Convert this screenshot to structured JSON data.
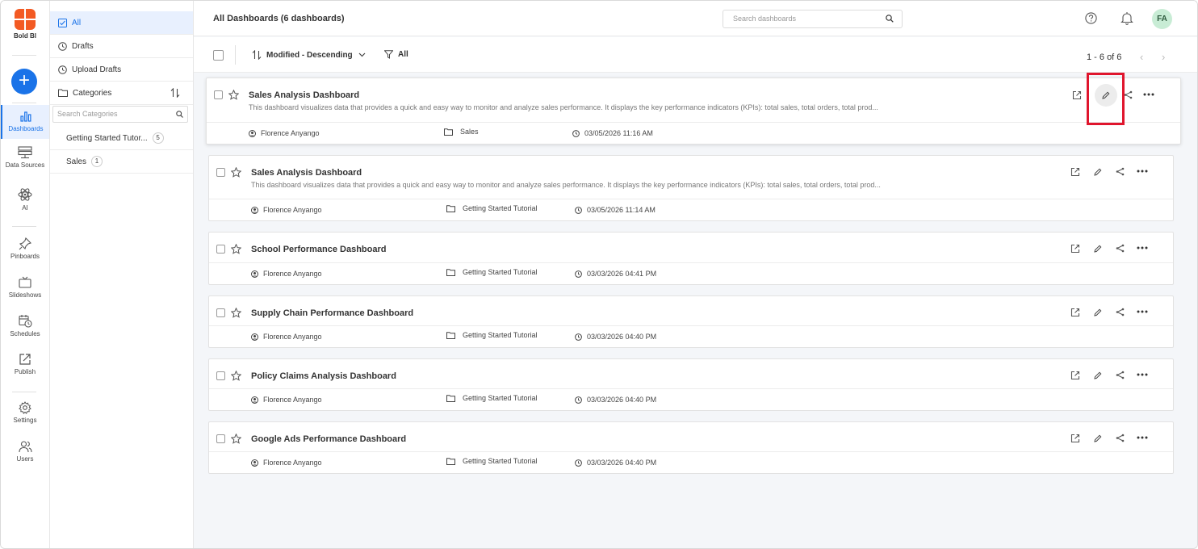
{
  "app": {
    "name": "Bold BI"
  },
  "rail": {
    "items": [
      {
        "label": "Dashboards"
      },
      {
        "label": "Data Sources"
      },
      {
        "label": "AI"
      },
      {
        "label": "Pinboards"
      },
      {
        "label": "Slideshows"
      },
      {
        "label": "Schedules"
      },
      {
        "label": "Publish"
      },
      {
        "label": "Settings"
      },
      {
        "label": "Users"
      }
    ]
  },
  "categories_panel": {
    "views": [
      {
        "label": "All"
      },
      {
        "label": "Drafts"
      },
      {
        "label": "Upload Drafts"
      },
      {
        "label": "Categories"
      }
    ],
    "search_placeholder": "Search Categories",
    "categories": [
      {
        "label": "Getting Started Tutor...",
        "count": "5"
      },
      {
        "label": "Sales",
        "count": "1"
      }
    ]
  },
  "header": {
    "title": "All Dashboards (6 dashboards)",
    "search_placeholder": "Search dashboards",
    "avatar_initials": "FA"
  },
  "toolbar": {
    "sort_label": "Modified - Descending",
    "filter_label": "All",
    "pagination": "1 - 6 of 6"
  },
  "dashboards": [
    {
      "title": "Sales Analysis Dashboard",
      "description": "This dashboard visualizes data that provides a quick and easy way to monitor and analyze sales performance. It displays the key performance indicators (KPIs): total sales, total orders, total prod...",
      "owner": "Florence Anyango",
      "category": "Sales",
      "modified": "03/05/2026 11:16 AM"
    },
    {
      "title": "Sales Analysis Dashboard",
      "description": "This dashboard visualizes data that provides a quick and easy way to monitor and analyze sales performance. It displays the key performance indicators (KPIs): total sales, total orders, total prod...",
      "owner": "Florence Anyango",
      "category": "Getting Started Tutorial",
      "modified": "03/05/2026 11:14 AM"
    },
    {
      "title": "School Performance Dashboard",
      "description": "",
      "owner": "Florence Anyango",
      "category": "Getting Started Tutorial",
      "modified": "03/03/2026 04:41 PM"
    },
    {
      "title": "Supply Chain Performance Dashboard",
      "description": "",
      "owner": "Florence Anyango",
      "category": "Getting Started Tutorial",
      "modified": "03/03/2026 04:40 PM"
    },
    {
      "title": "Policy Claims Analysis Dashboard",
      "description": "",
      "owner": "Florence Anyango",
      "category": "Getting Started Tutorial",
      "modified": "03/03/2026 04:40 PM"
    },
    {
      "title": "Google Ads Performance Dashboard",
      "description": "",
      "owner": "Florence Anyango",
      "category": "Getting Started Tutorial",
      "modified": "03/03/2026 04:40 PM"
    }
  ],
  "colors": {
    "accent": "#1a73e8",
    "brand": "#f35a23",
    "highlight": "#e0152d"
  }
}
